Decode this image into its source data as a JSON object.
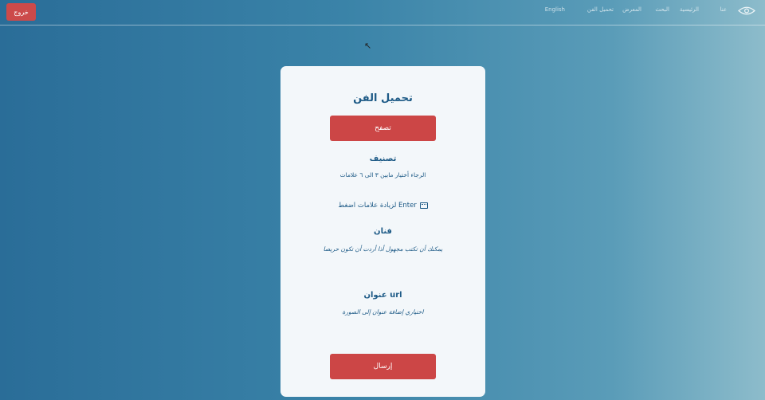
{
  "header": {
    "exit_label": "خروج",
    "nav": [
      "English",
      "تحميل الفن",
      "المعرض",
      "البحث",
      "الرئيسية",
      "عنا"
    ]
  },
  "cursor": "↖",
  "card": {
    "title": "تحميل الفن",
    "browse_label": "تصفح",
    "category": {
      "title": "تصنيف",
      "hint": "الرجاء أختيار مابين ٣ الى ٦ علامات",
      "enter_hint": "لزيادة علامات اضغط",
      "enter_key": "Enter"
    },
    "artist": {
      "title": "فنان",
      "hint": "يمكنك أن تكتب مجهول أذا أردت أن تكون حريصا"
    },
    "url": {
      "title": "عنوان url",
      "hint": "اختياري إضافة عنوان إلى الصورة"
    },
    "submit_label": "إرسال"
  }
}
